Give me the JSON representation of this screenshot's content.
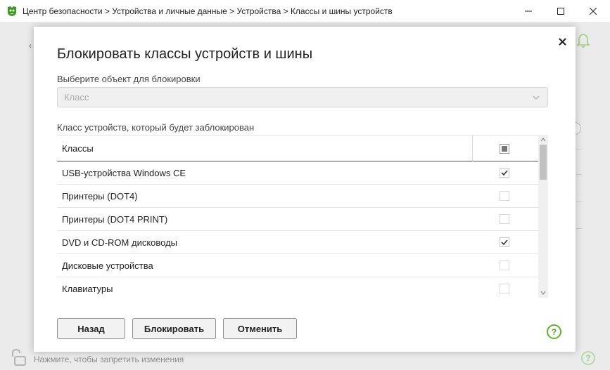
{
  "window": {
    "title": "Центр безопасности > Устройства и личные данные > Устройства > Классы и шины устройств",
    "minimize_glyph": "—",
    "maximize_glyph": "☐",
    "close_glyph": "✕"
  },
  "background": {
    "back_glyph": "‹",
    "lock_hint": "Нажмите, чтобы запретить изменения",
    "help_glyph": "?"
  },
  "dialog": {
    "title": "Блокировать классы устройств и шины",
    "close_glyph": "✕",
    "select_label": "Выберите объект для блокировки",
    "select_value": "Класс",
    "class_label": "Класс устройств, который будет заблокирован",
    "table": {
      "header": "Классы",
      "header_checkbox_state": "indeterminate",
      "rows": [
        {
          "label": "USB-устройства Windows CE",
          "checked": true
        },
        {
          "label": "Принтеры (DOT4)",
          "checked": false
        },
        {
          "label": "Принтеры (DOT4 PRINT)",
          "checked": false
        },
        {
          "label": "DVD и CD-ROM дисководы",
          "checked": true
        },
        {
          "label": "Дисковые устройства",
          "checked": false
        },
        {
          "label": "Клавиатуры",
          "checked": false
        }
      ]
    },
    "buttons": {
      "back": "Назад",
      "block": "Блокировать",
      "cancel": "Отменить"
    },
    "help_glyph": "?"
  },
  "colors": {
    "accent_green": "#5db32f",
    "app_icon_green": "#3a9a1e"
  }
}
